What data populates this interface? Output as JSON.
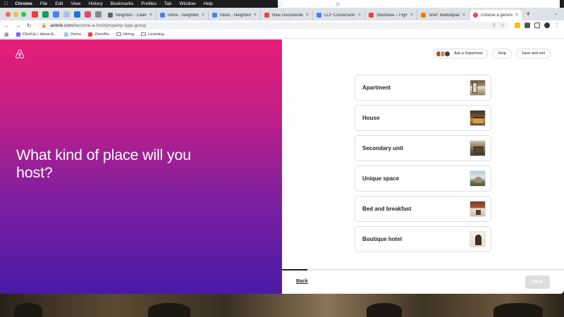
{
  "menubar": {
    "app": "Chrome",
    "items": [
      "File",
      "Edit",
      "View",
      "History",
      "Bookmarks",
      "Profiles",
      "Tab",
      "Window",
      "Help"
    ],
    "clock": "Fri Apr 8  3:25 PM"
  },
  "browser": {
    "tabs": [
      {
        "label": "Neighbor - Calendar",
        "color": "#5f6368"
      },
      {
        "label": "Inbox - Neighbor",
        "color": "#4285f4"
      },
      {
        "label": "Inbox - Neighbor",
        "color": "#4285f4"
      },
      {
        "label": "New Discoverability",
        "color": "#e8453c"
      },
      {
        "label": "LCF Conversion Rate",
        "color": "#4285f4"
      },
      {
        "label": "Stashbee – Figma",
        "color": "#e8453c"
      },
      {
        "label": "Shef: Marketplace fo",
        "color": "#f57c00"
      },
      {
        "label": "Choose a general p",
        "color": "#ff385c",
        "active": true
      }
    ],
    "url_host": "airbnb.com",
    "url_path": "/become-a-host/property-type-group",
    "bookmarks": [
      {
        "label": "ClickUp | Ideas &...",
        "color": "#7b68ee",
        "type": "site"
      },
      {
        "label": "Domo",
        "color": "#99ccee",
        "type": "site"
      },
      {
        "label": "Zenefits",
        "color": "#e8453c",
        "type": "site"
      },
      {
        "label": "Hiring",
        "type": "folder"
      },
      {
        "label": "Learning",
        "type": "folder"
      }
    ]
  },
  "hero": {
    "title": "What kind of place will you host?",
    "brand_color": "#ffffff"
  },
  "header_buttons": {
    "superhost": "Ask a Superhost",
    "help": "Help",
    "save_exit": "Save and exit"
  },
  "options": [
    {
      "label": "Apartment",
      "thumb": "apartment"
    },
    {
      "label": "House",
      "thumb": "house"
    },
    {
      "label": "Secondary unit",
      "thumb": "secondary"
    },
    {
      "label": "Unique space",
      "thumb": "unique"
    },
    {
      "label": "Bed and breakfast",
      "thumb": "bnb"
    },
    {
      "label": "Boutique hotel",
      "thumb": "hotel"
    }
  ],
  "footer": {
    "back": "Back",
    "next": "Next",
    "progress_fraction": 0.09
  }
}
